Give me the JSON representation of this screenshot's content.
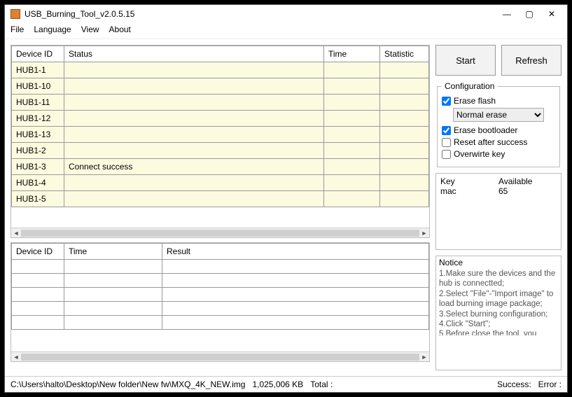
{
  "window": {
    "title": "USB_Burning_Tool_v2.0.5.15"
  },
  "menubar": {
    "file": "File",
    "language": "Language",
    "view": "View",
    "about": "About"
  },
  "device_table": {
    "headers": {
      "device_id": "Device ID",
      "status": "Status",
      "time": "Time",
      "statistic": "Statistic"
    },
    "rows": [
      {
        "device_id": "HUB1-1",
        "status": "",
        "time": "",
        "statistic": ""
      },
      {
        "device_id": "HUB1-10",
        "status": "",
        "time": "",
        "statistic": ""
      },
      {
        "device_id": "HUB1-11",
        "status": "",
        "time": "",
        "statistic": ""
      },
      {
        "device_id": "HUB1-12",
        "status": "",
        "time": "",
        "statistic": ""
      },
      {
        "device_id": "HUB1-13",
        "status": "",
        "time": "",
        "statistic": ""
      },
      {
        "device_id": "HUB1-2",
        "status": "",
        "time": "",
        "statistic": ""
      },
      {
        "device_id": "HUB1-3",
        "status": "Connect success",
        "time": "",
        "statistic": ""
      },
      {
        "device_id": "HUB1-4",
        "status": "",
        "time": "",
        "statistic": ""
      },
      {
        "device_id": "HUB1-5",
        "status": "",
        "time": "",
        "statistic": ""
      }
    ]
  },
  "log_table": {
    "headers": {
      "device_id": "Device ID",
      "time": "Time",
      "result": "Result"
    }
  },
  "buttons": {
    "start": "Start",
    "refresh": "Refresh"
  },
  "config": {
    "legend": "Configuration",
    "erase_flash_label": "Erase flash",
    "erase_flash_checked": true,
    "erase_mode_selected": "Normal erase",
    "erase_bootloader_label": "Erase bootloader",
    "erase_bootloader_checked": true,
    "reset_after_label": "Reset after success",
    "reset_after_checked": false,
    "overwrite_key_label": "Overwirte key",
    "overwrite_key_checked": false
  },
  "key_panel": {
    "header_key": "Key",
    "header_available": "Available",
    "rows": [
      {
        "key": "mac",
        "available": "65"
      }
    ]
  },
  "notice": {
    "title": "Notice",
    "body": "1.Make sure the devices and the hub is connectted;\n2.Select \"File\"-\"Import image\" to load burning image package;\n3.Select burning configuration;\n4.Click \"Start\";\n5.Before close the tool, you"
  },
  "statusbar": {
    "path": "C:\\Users\\halto\\Desktop\\New folder\\New fw\\MXQ_4K_NEW.img",
    "size": "1,025,006 KB",
    "total_label": "Total :",
    "success_label": "Success:",
    "error_label": "Error :"
  }
}
